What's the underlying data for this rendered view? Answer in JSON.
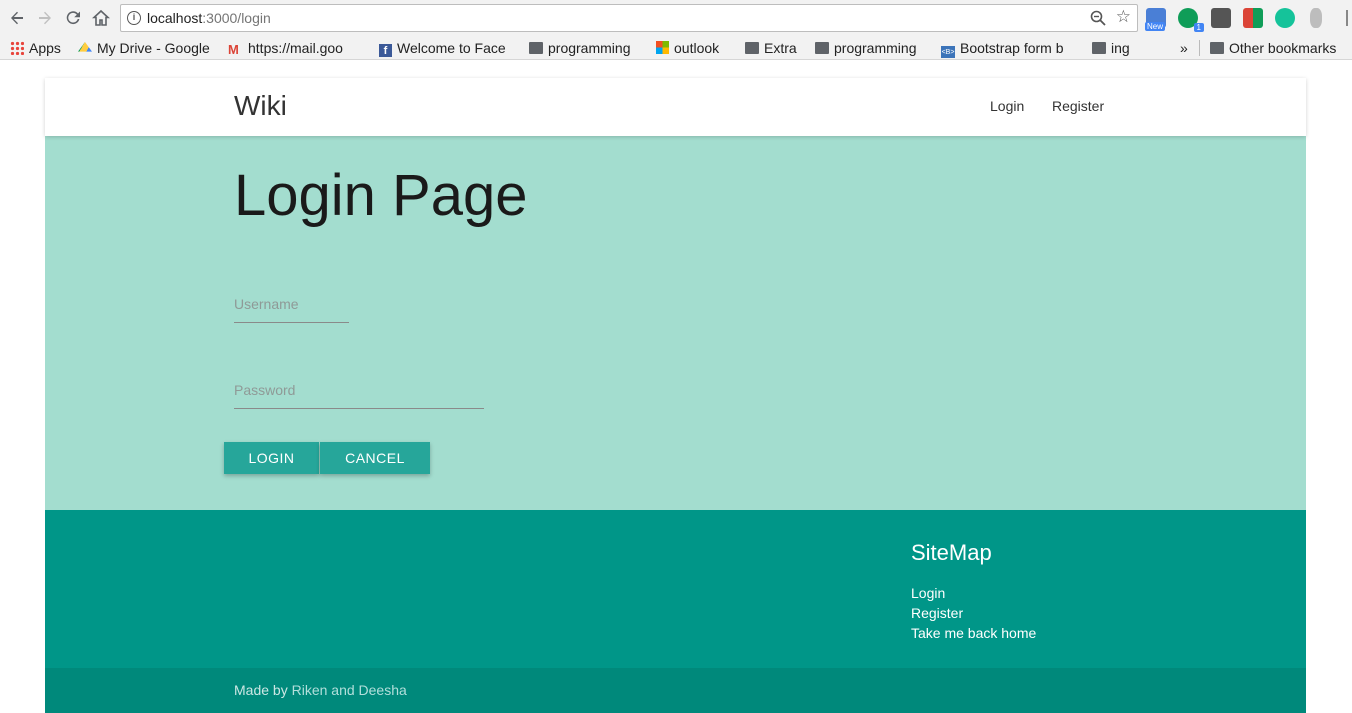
{
  "browser": {
    "url_host": "localhost",
    "url_path": ":3000/login",
    "info_glyph": "i",
    "ext_badge": "New",
    "ext_count": "1",
    "bookmarks": [
      {
        "label": "Apps",
        "icon": "apps-grid-icon"
      },
      {
        "label": "My Drive - Google",
        "icon": "google-drive-icon"
      },
      {
        "label": "https://mail.goo",
        "icon": "gmail-icon"
      },
      {
        "label": "Welcome to Face",
        "icon": "facebook-icon"
      },
      {
        "label": "programming",
        "icon": "folder-icon"
      },
      {
        "label": "outlook",
        "icon": "microsoft-icon"
      },
      {
        "label": "Extra",
        "icon": "folder-icon"
      },
      {
        "label": "programming",
        "icon": "folder-icon"
      },
      {
        "label": "Bootstrap form b",
        "icon": "bootstrap-icon"
      },
      {
        "label": "ing",
        "icon": "folder-icon"
      }
    ],
    "overflow": "»",
    "other_bookmarks": "Other bookmarks"
  },
  "navbar": {
    "brand": "Wiki",
    "links": [
      "Login",
      "Register"
    ]
  },
  "hero": {
    "title": "Login Page",
    "username_placeholder": "Username",
    "password_placeholder": "Password",
    "login_label": "LOGIN",
    "cancel_label": "CANCEL"
  },
  "footer": {
    "sitemap_title": "SiteMap",
    "links": [
      "Login",
      "Register",
      "Take me back home"
    ],
    "made_by_prefix": "Made by ",
    "made_by_authors": "Riken and Deesha"
  },
  "colors": {
    "hero_bg": "#a3ddcf",
    "button": "#26a69a",
    "footer": "#009688",
    "copyright": "#00897b"
  }
}
